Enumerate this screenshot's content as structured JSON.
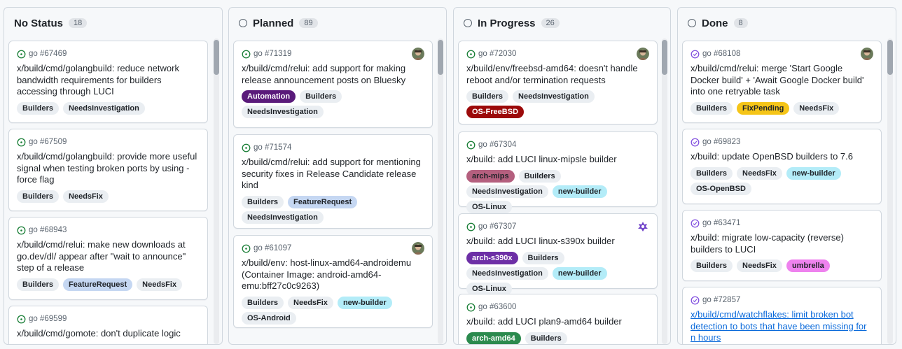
{
  "columns": [
    {
      "title": "No Status",
      "count": "18",
      "show_circle": false,
      "cards": [
        {
          "ref": "go #67469",
          "title": "x/build/cmd/golangbuild: reduce network bandwidth requirements for builders accessing through LUCI",
          "status": "open",
          "avatar": "none",
          "link": false,
          "labels": [
            {
              "text": "Builders",
              "color": "#eaeef2",
              "fg": "#1f2328"
            },
            {
              "text": "NeedsInvestigation",
              "color": "#eaeef2",
              "fg": "#1f2328"
            }
          ]
        },
        {
          "ref": "go #67509",
          "title": "x/build/cmd/golangbuild: provide more useful signal when testing broken ports by using -force flag",
          "status": "open",
          "avatar": "none",
          "link": false,
          "labels": [
            {
              "text": "Builders",
              "color": "#eaeef2",
              "fg": "#1f2328"
            },
            {
              "text": "NeedsFix",
              "color": "#eaeef2",
              "fg": "#1f2328"
            }
          ]
        },
        {
          "ref": "go #68943",
          "title": "x/build/cmd/relui: make new downloads at go.dev/dl/ appear after \"wait to announce\" step of a release",
          "status": "open",
          "avatar": "none",
          "link": false,
          "labels": [
            {
              "text": "Builders",
              "color": "#eaeef2",
              "fg": "#1f2328"
            },
            {
              "text": "FeatureRequest",
              "color": "#c5d7f2",
              "fg": "#1f2328"
            },
            {
              "text": "NeedsFix",
              "color": "#eaeef2",
              "fg": "#1f2328"
            }
          ]
        },
        {
          "ref": "go #69599",
          "title": "x/build/cmd/gomote: don't duplicate logic",
          "status": "open",
          "avatar": "none",
          "link": false,
          "labels": []
        }
      ]
    },
    {
      "title": "Planned",
      "count": "89",
      "show_circle": true,
      "cards": [
        {
          "ref": "go #71319",
          "title": "x/build/cmd/relui: add support for making release announcement posts on Bluesky",
          "status": "open",
          "avatar": "photo",
          "link": false,
          "labels": [
            {
              "text": "Automation",
              "color": "#5a1a7a",
              "fg": "#ffffff"
            },
            {
              "text": "Builders",
              "color": "#eaeef2",
              "fg": "#1f2328"
            },
            {
              "text": "NeedsInvestigation",
              "color": "#eaeef2",
              "fg": "#1f2328"
            }
          ]
        },
        {
          "ref": "go #71574",
          "title": "x/build/cmd/relui: add support for mentioning security fixes in Release Candidate release kind",
          "status": "open",
          "avatar": "none",
          "link": false,
          "labels": [
            {
              "text": "Builders",
              "color": "#eaeef2",
              "fg": "#1f2328"
            },
            {
              "text": "FeatureRequest",
              "color": "#c5d7f2",
              "fg": "#1f2328"
            },
            {
              "text": "NeedsInvestigation",
              "color": "#eaeef2",
              "fg": "#1f2328"
            }
          ]
        },
        {
          "ref": "go #61097",
          "title": "x/build/env: host-linux-amd64-androidemu (Container Image: android-amd64-emu:bff27c0c9263)",
          "status": "open",
          "avatar": "photo",
          "link": false,
          "labels": [
            {
              "text": "Builders",
              "color": "#eaeef2",
              "fg": "#1f2328"
            },
            {
              "text": "NeedsFix",
              "color": "#eaeef2",
              "fg": "#1f2328"
            },
            {
              "text": "new-builder",
              "color": "#b3ecf8",
              "fg": "#1f2328"
            },
            {
              "text": "OS-Android",
              "color": "#eaeef2",
              "fg": "#1f2328"
            }
          ]
        }
      ]
    },
    {
      "title": "In Progress",
      "count": "26",
      "show_circle": true,
      "cards": [
        {
          "ref": "go #72030",
          "title": "x/build/env/freebsd-amd64: doesn't handle reboot and/or termination requests",
          "status": "open",
          "avatar": "photo",
          "link": false,
          "labels": [
            {
              "text": "Builders",
              "color": "#eaeef2",
              "fg": "#1f2328"
            },
            {
              "text": "NeedsInvestigation",
              "color": "#eaeef2",
              "fg": "#1f2328"
            },
            {
              "text": "OS-FreeBSD",
              "color": "#9c0a0a",
              "fg": "#ffffff"
            }
          ]
        },
        {
          "ref": "go #67304",
          "title": "x/build: add LUCI linux-mipsle builder",
          "status": "open",
          "avatar": "none",
          "link": false,
          "labels": [
            {
              "text": "arch-mips",
              "color": "#b45f7e",
              "fg": "#1f2328"
            },
            {
              "text": "Builders",
              "color": "#eaeef2",
              "fg": "#1f2328"
            },
            {
              "text": "NeedsInvestigation",
              "color": "#eaeef2",
              "fg": "#1f2328"
            },
            {
              "text": "new-builder",
              "color": "#b3ecf8",
              "fg": "#1f2328"
            },
            {
              "text": "OS-Linux",
              "color": "#eaeef2",
              "fg": "#1f2328"
            }
          ]
        },
        {
          "ref": "go #67307",
          "title": "x/build: add LUCI linux-s390x builder",
          "status": "open",
          "avatar": "bot",
          "link": false,
          "labels": [
            {
              "text": "arch-s390x",
              "color": "#6d2fa6",
              "fg": "#ffffff"
            },
            {
              "text": "Builders",
              "color": "#eaeef2",
              "fg": "#1f2328"
            },
            {
              "text": "NeedsInvestigation",
              "color": "#eaeef2",
              "fg": "#1f2328"
            },
            {
              "text": "new-builder",
              "color": "#b3ecf8",
              "fg": "#1f2328"
            },
            {
              "text": "OS-Linux",
              "color": "#eaeef2",
              "fg": "#1f2328"
            }
          ]
        },
        {
          "ref": "go #63600",
          "title": "x/build: add LUCI plan9-amd64 builder",
          "status": "open",
          "avatar": "none",
          "link": false,
          "labels": [
            {
              "text": "arch-amd64",
              "color": "#2b8a4e",
              "fg": "#ffffff"
            },
            {
              "text": "Builders",
              "color": "#eaeef2",
              "fg": "#1f2328"
            }
          ]
        }
      ]
    },
    {
      "title": "Done",
      "count": "8",
      "show_circle": true,
      "cards": [
        {
          "ref": "go #68108",
          "title": "x/build/cmd/relui: merge 'Start Google Docker build' + 'Await Google Docker build' into one retryable task",
          "status": "closed",
          "avatar": "photo",
          "link": false,
          "labels": [
            {
              "text": "Builders",
              "color": "#eaeef2",
              "fg": "#1f2328"
            },
            {
              "text": "FixPending",
              "color": "#f5c518",
              "fg": "#1f2328"
            },
            {
              "text": "NeedsFix",
              "color": "#eaeef2",
              "fg": "#1f2328"
            }
          ]
        },
        {
          "ref": "go #69823",
          "title": "x/build: update OpenBSD builders to 7.6",
          "status": "closed",
          "avatar": "none",
          "link": false,
          "labels": [
            {
              "text": "Builders",
              "color": "#eaeef2",
              "fg": "#1f2328"
            },
            {
              "text": "NeedsFix",
              "color": "#eaeef2",
              "fg": "#1f2328"
            },
            {
              "text": "new-builder",
              "color": "#b3ecf8",
              "fg": "#1f2328"
            },
            {
              "text": "OS-OpenBSD",
              "color": "#eaeef2",
              "fg": "#1f2328"
            }
          ]
        },
        {
          "ref": "go #63471",
          "title": "x/build: migrate low-capacity (reverse) builders to LUCI",
          "status": "closed",
          "avatar": "none",
          "link": false,
          "labels": [
            {
              "text": "Builders",
              "color": "#eaeef2",
              "fg": "#1f2328"
            },
            {
              "text": "NeedsFix",
              "color": "#eaeef2",
              "fg": "#1f2328"
            },
            {
              "text": "umbrella",
              "color": "#ee82ee",
              "fg": "#1f2328"
            }
          ]
        },
        {
          "ref": "go #72857",
          "title": "x/build/cmd/watchflakes: limit broken bot detection to bots that have been missing for n hours",
          "status": "closed",
          "avatar": "none",
          "link": true,
          "labels": []
        }
      ]
    }
  ],
  "colors": {
    "open": "#1a7f37",
    "closed": "#8250df",
    "link": "#0969da",
    "border": "#d0d7de"
  }
}
